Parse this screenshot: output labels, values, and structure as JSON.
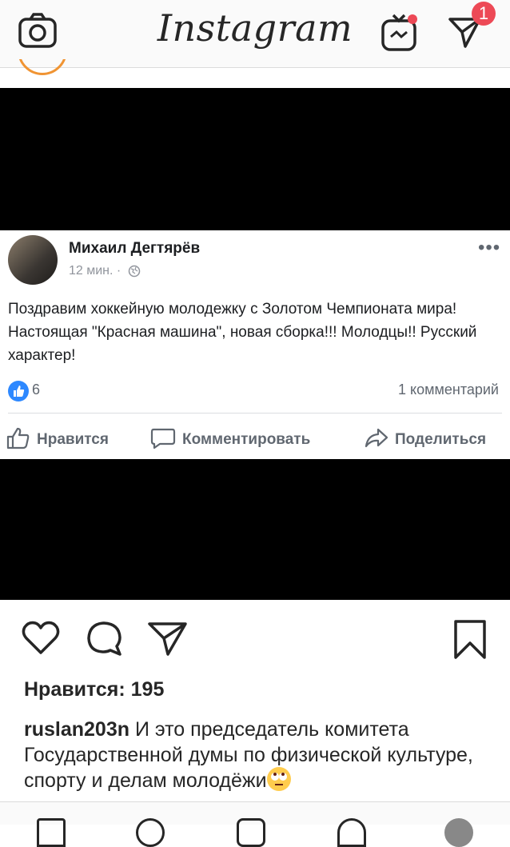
{
  "header": {
    "logo": "Instagram",
    "camera_icon": "camera-icon",
    "igtv_icon": "igtv-icon",
    "direct_icon": "paper-plane-icon",
    "direct_badge": "1"
  },
  "fb_post": {
    "author": "Михаил Дегтярёв",
    "time": "12 мин. ·",
    "body": "Поздравим хоккейную молодежку с Золотом Чемпионата мира! Настоящая \"Красная машина\", новая сборка!!! Молодцы!! Русский характер!",
    "likes": "6",
    "comments": "1 комментарий",
    "actions": {
      "like": "Нравится",
      "comment": "Комментировать",
      "share": "Поделиться"
    },
    "accent": "#2d88ff"
  },
  "post": {
    "likes": "Нравится: 195",
    "username": "ruslan203n",
    "caption": "И это председатель комитета Государственной думы по физической культуре, спорту и делам молодёжи",
    "caption_emoji": "face-with-rolling-eyes-emoji"
  },
  "colors": {
    "badge": "#ed4956",
    "text": "#262626"
  }
}
